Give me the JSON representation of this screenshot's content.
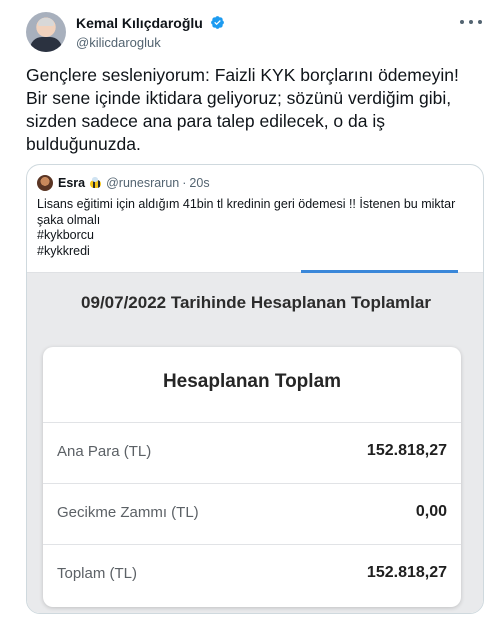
{
  "author": {
    "name": "Kemal Kılıçdaroğlu",
    "handle": "@kilicdarogluk"
  },
  "tweet": {
    "text": "Gençlere sesleniyorum: Faizli KYK borçlarını ödemeyin! Bir sene içinde iktidara geliyoruz; sözünü verdiğim gibi, sizden sadece ana para talep edilecek, o da iş bulduğunuzda."
  },
  "quote": {
    "name": "Esra",
    "handle": "@runesrarun",
    "separator": "·",
    "time": "20s",
    "body": "Lisans eğitimi için aldığım 41bin tl kredinin geri ödemesi !! İstenen bu miktar şaka olmalı",
    "hashtags": [
      "#kykborcu",
      "#kykkredi"
    ]
  },
  "calculation": {
    "heading": "09/07/2022 Tarihinde Hesaplanan Toplamlar",
    "card_title": "Hesaplanan Toplam",
    "rows": [
      {
        "label": "Ana Para (TL)",
        "value": "152.818,27"
      },
      {
        "label": "Gecikme Zammı (TL)",
        "value": "0,00"
      },
      {
        "label": "Toplam (TL)",
        "value": "152.818,27"
      }
    ]
  },
  "colors": {
    "verified": "#1d9bf0",
    "progress": "#3a87d9"
  }
}
